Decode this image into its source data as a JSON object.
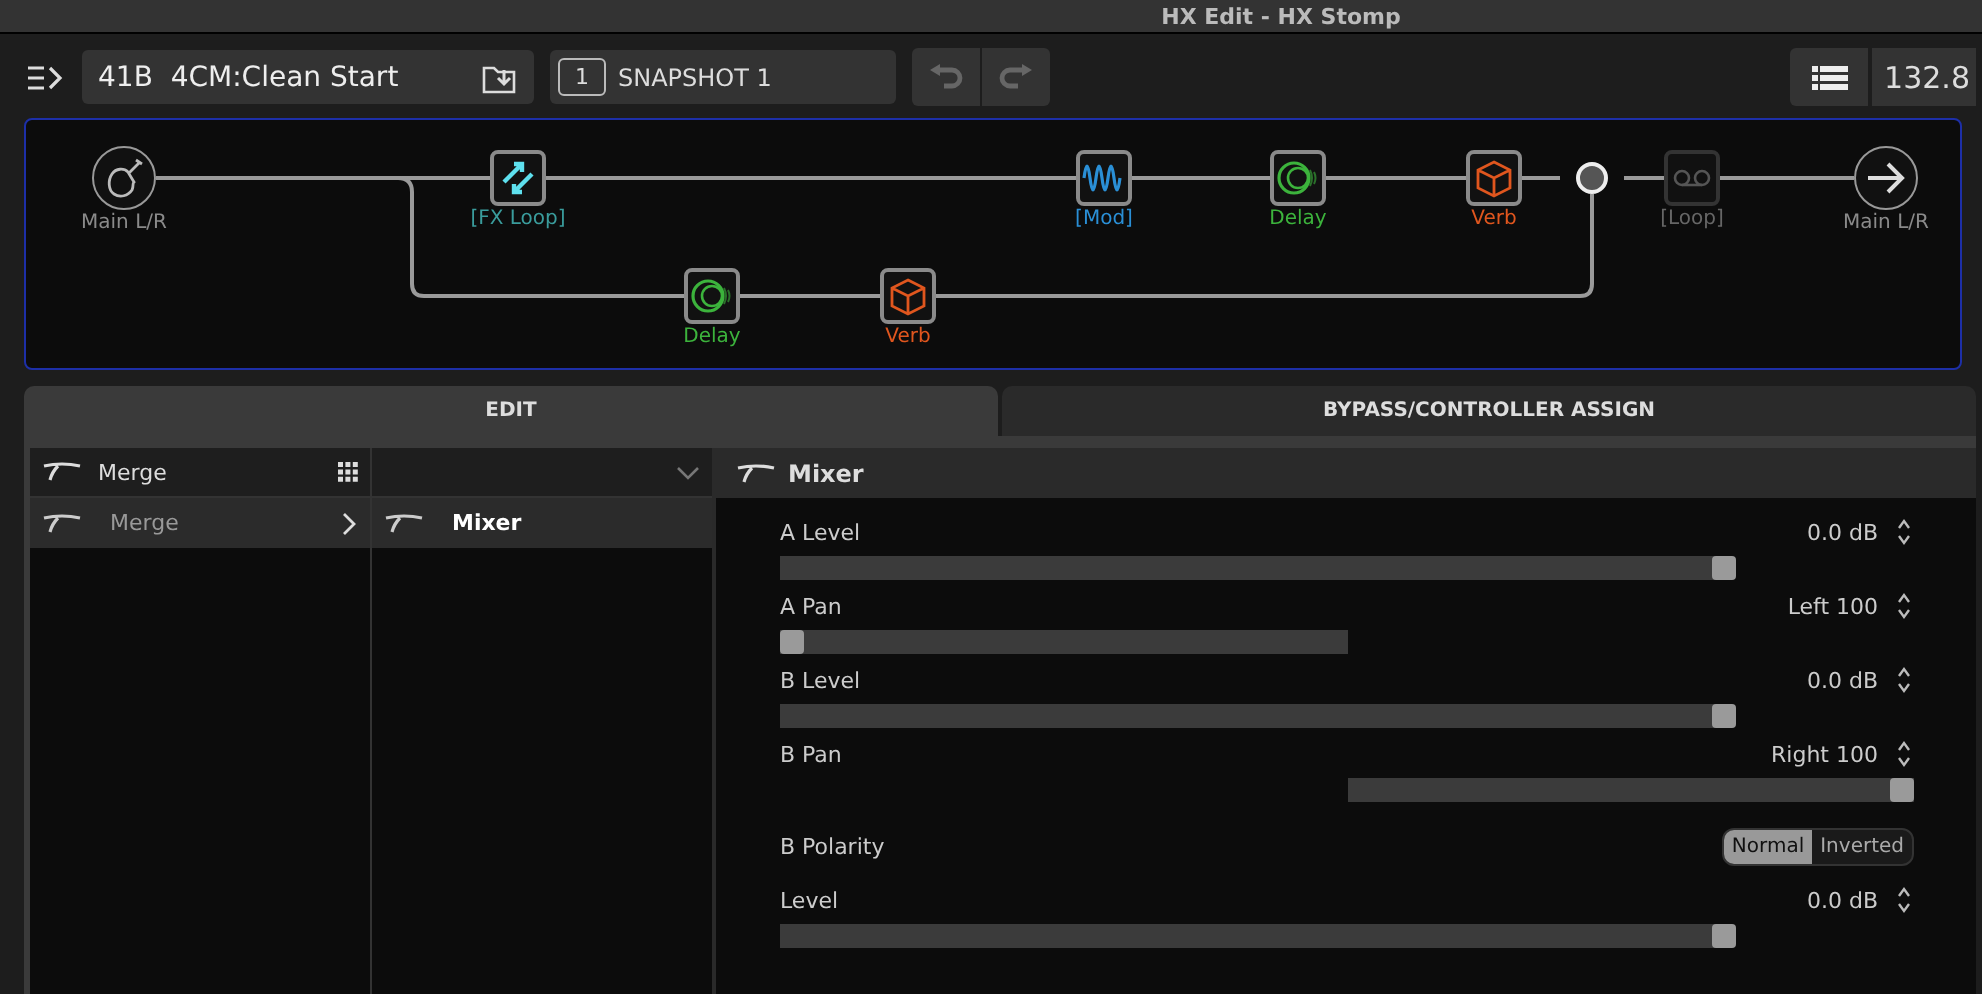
{
  "window": {
    "title": "HX Edit - HX Stomp"
  },
  "toolbar": {
    "preset": "41B  4CM:Clean Start",
    "snapshot_number": "1",
    "snapshot": "SNAPSHOT 1",
    "tempo": "132.8"
  },
  "routing": {
    "path_a": [
      {
        "kind": "input",
        "label": "Main L/R",
        "color": "#8a8a8a"
      },
      {
        "kind": "fxloop",
        "label": "[FX Loop]",
        "color": "#3a9c9c",
        "bypassed": false
      },
      {
        "kind": "mod",
        "label": "[Mod]",
        "color": "#2a8fd6",
        "bypassed": false
      },
      {
        "kind": "delay",
        "label": "Delay",
        "color": "#3cb33c",
        "bypassed": false
      },
      {
        "kind": "verb",
        "label": "Verb",
        "color": "#e0561e",
        "bypassed": false
      },
      {
        "kind": "loop",
        "label": "[Loop]",
        "color": "#666666",
        "bypassed": true
      },
      {
        "kind": "output",
        "label": "Main L/R",
        "color": "#8a8a8a"
      }
    ],
    "path_b": [
      {
        "kind": "delay",
        "label": "Delay",
        "color": "#3cb33c",
        "bypassed": false
      },
      {
        "kind": "verb",
        "label": "Verb",
        "color": "#e0561e",
        "bypassed": false
      }
    ]
  },
  "tabs": [
    {
      "label": "EDIT",
      "selected": true
    },
    {
      "label": "BYPASS/CONTROLLER ASSIGN",
      "selected": false
    }
  ],
  "browser": {
    "category": "Merge",
    "categories": [
      {
        "label": "Merge",
        "selected": true
      }
    ],
    "models": [
      {
        "label": "Mixer",
        "selected": true
      }
    ]
  },
  "params": {
    "title": "Mixer",
    "rows": [
      {
        "kind": "slider",
        "label": "A Level",
        "value": "0.0 dB",
        "level": 0.84
      },
      {
        "kind": "pan",
        "label": "A Pan",
        "value": "Left 100",
        "level": 0
      },
      {
        "kind": "slider",
        "label": "B Level",
        "value": "0.0 dB",
        "level": 0.84
      },
      {
        "kind": "pan",
        "label": "B Pan",
        "value": "Right 100",
        "level": 1
      },
      {
        "kind": "toggle",
        "label": "B Polarity",
        "options": [
          {
            "label": "Normal",
            "selected": true
          },
          {
            "label": "Inverted",
            "selected": false
          }
        ]
      },
      {
        "kind": "slider",
        "label": "Level",
        "value": "0.0 dB",
        "level": 0.84
      }
    ]
  }
}
